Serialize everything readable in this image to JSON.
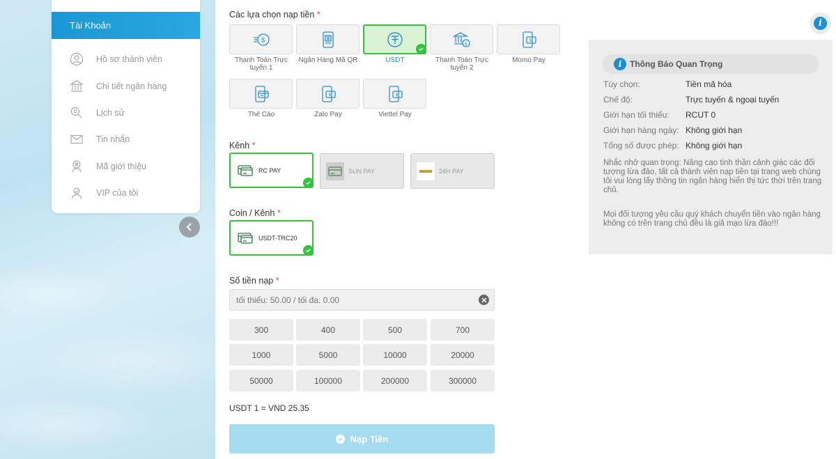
{
  "sidebar": {
    "account_tab": "Tài Khoản",
    "items": [
      {
        "label": "Hồ sơ thành viên",
        "icon": "user-icon"
      },
      {
        "label": "Chi tiết ngân hàng",
        "icon": "bank-icon"
      },
      {
        "label": "Lịch sử",
        "icon": "history-icon"
      },
      {
        "label": "Tin nhắn",
        "icon": "mail-icon"
      },
      {
        "label": "Mã giới thiệu",
        "icon": "referral-icon"
      },
      {
        "label": "VIP của tôi",
        "icon": "vip-icon"
      }
    ]
  },
  "deposit": {
    "methods_label": "Các lựa chọn nạp tiền",
    "required_mark": "*",
    "methods": [
      {
        "label": "Thanh Toán Trực tuyến 1",
        "icon": "fast-pay-icon",
        "selected": false
      },
      {
        "label": "Ngân Hàng Mã QR",
        "icon": "qr-phone-icon",
        "selected": false
      },
      {
        "label": "USDT",
        "icon": "tether-icon",
        "selected": true
      },
      {
        "label": "Thanh Toán Trực tuyến 2",
        "icon": "bank-coin-icon",
        "selected": false
      },
      {
        "label": "Momo Pay",
        "icon": "wallet-phone-icon",
        "selected": false
      },
      {
        "label": "Thẻ Cào",
        "icon": "card-phone-icon",
        "selected": false
      },
      {
        "label": "Zalo Pay",
        "icon": "wallet-phone-icon",
        "selected": false
      },
      {
        "label": "Viettel Pay",
        "icon": "wallet-phone-icon",
        "selected": false
      }
    ],
    "channel_label": "Kênh",
    "channels": [
      {
        "label": "RC PAY",
        "selected": true
      },
      {
        "label": "SUN PAY",
        "selected": false
      },
      {
        "label": "24H PAY",
        "selected": false
      }
    ],
    "coin_label": "Coin / Kênh",
    "coins": [
      {
        "label": "USDT-TRC20",
        "selected": true
      }
    ],
    "amount_label": "Số tiền nạp",
    "amount_placeholder": "tối thiểu: 50.00 / tối đa: 0.00",
    "amount_buttons": [
      "300",
      "400",
      "500",
      "700",
      "1000",
      "5000",
      "10000",
      "20000",
      "50000",
      "100000",
      "200000",
      "300000"
    ],
    "rate_text": "USDT 1 = VND 25.35",
    "submit_label": "Nạp Tiền"
  },
  "notice": {
    "title": "Thông Báo Quan Trọng",
    "rows": [
      {
        "key": "Tùy chọn:",
        "value": "Tiền mã hóa"
      },
      {
        "key": "Chế độ:",
        "value": "Trực tuyến & ngoại tuyến"
      },
      {
        "key": "Giới hạn tối thiểu:",
        "value": "RCUT 0"
      },
      {
        "key": "Giới hạn hàng ngày:",
        "value": "Không giới hạn"
      },
      {
        "key": "Tổng số được phép:",
        "value": "Không giới hạn"
      }
    ],
    "paragraph1": "Nhắc nhở quan trọng: Nâng cao tinh thần cảnh giác các đối tượng lừa đảo, tất cả thành viên nạp tiền tại trang web chúng tôi vui lòng lấy thông tin ngân hàng hiển thị tức thời trên trang chủ.",
    "paragraph2": "Mọi đối tượng yêu cầu quý khách chuyển tiền vào ngân hàng không có trên trang chủ đều là giả mạo lừa đảo!!!"
  },
  "colors": {
    "accent": "#1a98d5",
    "selected_border": "#35c23c",
    "submit_bg": "#a6dcef"
  }
}
